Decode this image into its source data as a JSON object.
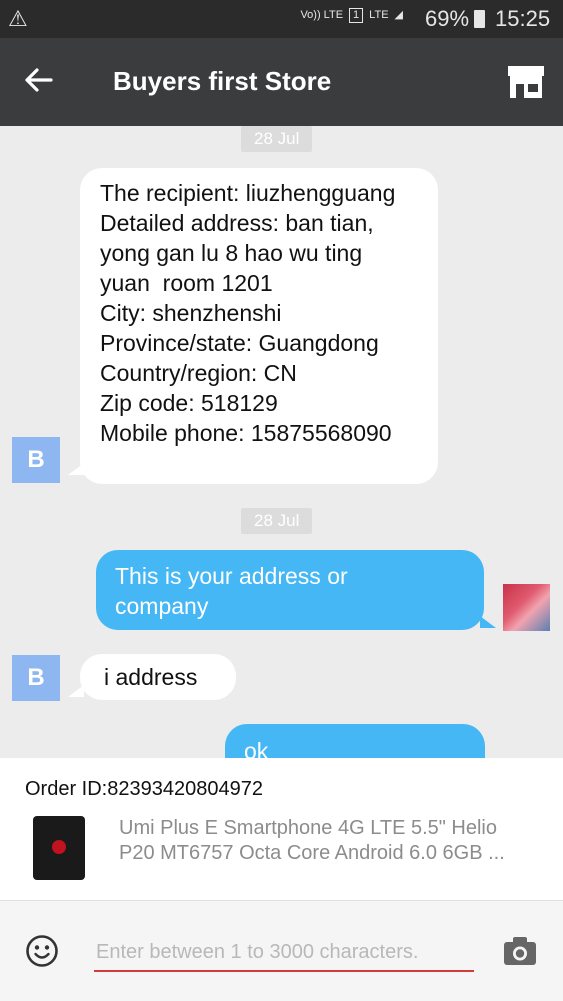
{
  "status_bar": {
    "warning_icon": "warning-icon",
    "volte_label": "Vo)) LTE",
    "sim_label": "1",
    "lte_label": "LTE",
    "battery_percent": "69%",
    "time": "15:25"
  },
  "app_bar": {
    "title": "Buyers first Store",
    "back_icon": "arrow-left-icon",
    "store_icon": "store-icon"
  },
  "chat": {
    "messages": [
      {
        "date": "28 Jul",
        "sender": "B",
        "side": "left",
        "lines": [
          "The recipient: liuzhengguang",
          "Detailed address: ban tian,",
          "yong gan lu 8 hao wu ting",
          "yuan  room 1201",
          "City: shenzhenshi",
          "Province/state: Guangdong",
          "Country/region: CN",
          "Zip code: 518129",
          "Mobile phone: 15875568090"
        ]
      },
      {
        "date": "28 Jul",
        "side": "right",
        "lines": [
          "This is your address or",
          "company"
        ]
      },
      {
        "sender": "B",
        "side": "left",
        "lines": [
          "i address"
        ]
      },
      {
        "side": "right",
        "lines": [
          "ok"
        ]
      }
    ]
  },
  "order": {
    "order_id": "Order ID:82393420804972",
    "product_lines": [
      "Umi Plus E Smartphone 4G LTE 5.5\" Helio",
      "P20 MT6757 Octa Core Android 6.0 6GB ..."
    ]
  },
  "input": {
    "placeholder": "Enter between 1 to 3000 characters.",
    "emoji_icon": "smiley-icon",
    "camera_icon": "camera-icon"
  },
  "colors": {
    "app_bar": "#3a3c3e",
    "bubble_out": "#45b7f5",
    "avatar_b": "#8eb7f2",
    "accent_underline": "#d43b3b"
  }
}
